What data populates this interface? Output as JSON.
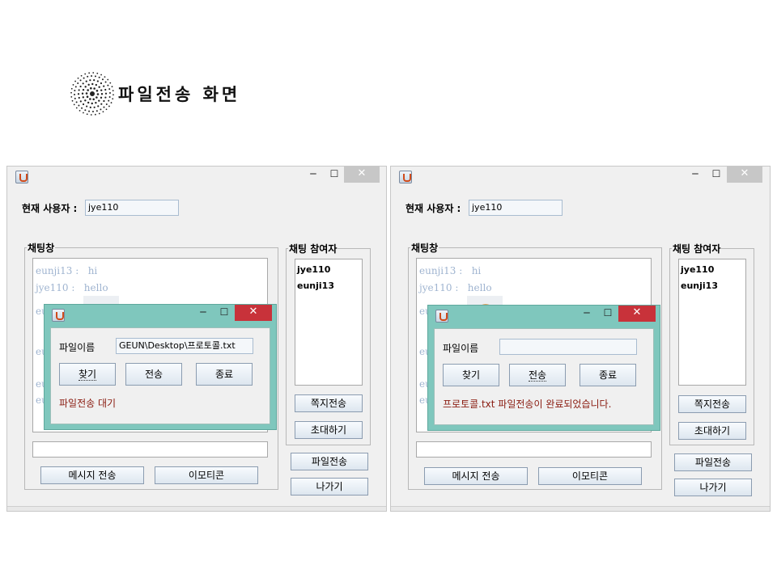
{
  "slide": {
    "title": "파일전송 화면"
  },
  "windows": [
    {
      "current_user_label": "현재 사용자 :",
      "current_user_value": "jye110",
      "chat_group_label": "채팅창",
      "participants_group_label": "채팅 참여자",
      "chat_lines": [
        "eunji13 :   hi",
        "jye110 :   hello"
      ],
      "chat_fragment": "eu",
      "participants": [
        "jye110",
        "eunji13"
      ],
      "buttons": {
        "note": "쪽지전송",
        "invite": "초대하기",
        "file": "파일전송",
        "exit": "나가기",
        "send_message": "메시지 전송",
        "emoticon": "이모티콘"
      },
      "dialog": {
        "file_label": "파일이름",
        "file_value": "GEUN\\Desktop\\프로토콜.txt",
        "find": "찾기",
        "send": "전송",
        "close": "종료",
        "status": "파일전송 대기"
      }
    },
    {
      "current_user_label": "현재 사용자 :",
      "current_user_value": "jye110",
      "chat_group_label": "채팅창",
      "participants_group_label": "채팅 참여자",
      "chat_lines": [
        "eunji13 :   hi",
        "jye110 :   hello"
      ],
      "chat_fragment": "eu",
      "participants": [
        "jye110",
        "eunji13"
      ],
      "buttons": {
        "note": "쪽지전송",
        "invite": "초대하기",
        "file": "파일전송",
        "exit": "나가기",
        "send_message": "메시지 전송",
        "emoticon": "이모티콘"
      },
      "dialog": {
        "file_label": "파일이름",
        "file_value": "",
        "find": "찾기",
        "send": "전송",
        "close": "종료",
        "status": "프로토콜.txt 파일전송이 완료되었습니다."
      }
    }
  ],
  "colors": {
    "dialog_frame": "#7fc7bd",
    "close_red": "#c8323a",
    "status_text": "#8a1b10",
    "chat_text": "#9fb4d0"
  }
}
